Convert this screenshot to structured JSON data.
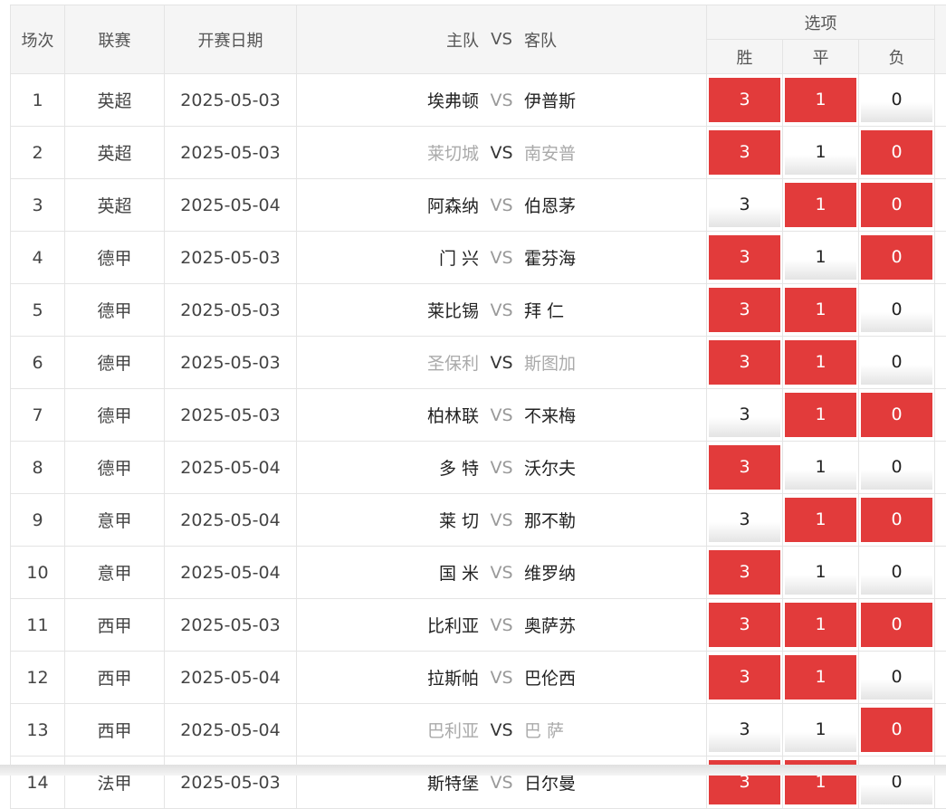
{
  "header": {
    "idx": "场次",
    "league": "联赛",
    "date": "开赛日期",
    "home": "主队",
    "vs": "VS",
    "away": "客队",
    "options_group": "选项",
    "win": "胜",
    "draw": "平",
    "loss": "负"
  },
  "rows": [
    {
      "idx": "1",
      "league": "英超",
      "date": "2025-05-03",
      "home": "埃弗顿",
      "vs": "VS",
      "away": "伊普斯",
      "win": "3",
      "draw": "1",
      "loss": "0",
      "sel": [
        true,
        true,
        false
      ],
      "dim": false
    },
    {
      "idx": "2",
      "league": "英超",
      "date": "2025-05-03",
      "home": "莱切城",
      "vs": "VS",
      "away": "南安普",
      "win": "3",
      "draw": "1",
      "loss": "0",
      "sel": [
        true,
        false,
        true
      ],
      "dim": true
    },
    {
      "idx": "3",
      "league": "英超",
      "date": "2025-05-04",
      "home": "阿森纳",
      "vs": "VS",
      "away": "伯恩茅",
      "win": "3",
      "draw": "1",
      "loss": "0",
      "sel": [
        false,
        true,
        true
      ],
      "dim": false
    },
    {
      "idx": "4",
      "league": "德甲",
      "date": "2025-05-03",
      "home": "门 兴",
      "vs": "VS",
      "away": "霍芬海",
      "win": "3",
      "draw": "1",
      "loss": "0",
      "sel": [
        true,
        false,
        true
      ],
      "dim": false
    },
    {
      "idx": "5",
      "league": "德甲",
      "date": "2025-05-03",
      "home": "莱比锡",
      "vs": "VS",
      "away": "拜 仁",
      "win": "3",
      "draw": "1",
      "loss": "0",
      "sel": [
        true,
        true,
        false
      ],
      "dim": false
    },
    {
      "idx": "6",
      "league": "德甲",
      "date": "2025-05-03",
      "home": "圣保利",
      "vs": "VS",
      "away": "斯图加",
      "win": "3",
      "draw": "1",
      "loss": "0",
      "sel": [
        true,
        true,
        false
      ],
      "dim": true
    },
    {
      "idx": "7",
      "league": "德甲",
      "date": "2025-05-03",
      "home": "柏林联",
      "vs": "VS",
      "away": "不来梅",
      "win": "3",
      "draw": "1",
      "loss": "0",
      "sel": [
        false,
        true,
        true
      ],
      "dim": false
    },
    {
      "idx": "8",
      "league": "德甲",
      "date": "2025-05-04",
      "home": "多 特",
      "vs": "VS",
      "away": "沃尔夫",
      "win": "3",
      "draw": "1",
      "loss": "0",
      "sel": [
        true,
        false,
        false
      ],
      "dim": false
    },
    {
      "idx": "9",
      "league": "意甲",
      "date": "2025-05-04",
      "home": "莱 切",
      "vs": "VS",
      "away": "那不勒",
      "win": "3",
      "draw": "1",
      "loss": "0",
      "sel": [
        false,
        true,
        true
      ],
      "dim": false
    },
    {
      "idx": "10",
      "league": "意甲",
      "date": "2025-05-04",
      "home": "国 米",
      "vs": "VS",
      "away": "维罗纳",
      "win": "3",
      "draw": "1",
      "loss": "0",
      "sel": [
        true,
        false,
        false
      ],
      "dim": false
    },
    {
      "idx": "11",
      "league": "西甲",
      "date": "2025-05-03",
      "home": "比利亚",
      "vs": "VS",
      "away": "奥萨苏",
      "win": "3",
      "draw": "1",
      "loss": "0",
      "sel": [
        true,
        true,
        true
      ],
      "dim": false
    },
    {
      "idx": "12",
      "league": "西甲",
      "date": "2025-05-04",
      "home": "拉斯帕",
      "vs": "VS",
      "away": "巴伦西",
      "win": "3",
      "draw": "1",
      "loss": "0",
      "sel": [
        true,
        true,
        false
      ],
      "dim": false
    },
    {
      "idx": "13",
      "league": "西甲",
      "date": "2025-05-04",
      "home": "巴利亚",
      "vs": "VS",
      "away": "巴 萨",
      "win": "3",
      "draw": "1",
      "loss": "0",
      "sel": [
        false,
        false,
        true
      ],
      "dim": true
    },
    {
      "idx": "14",
      "league": "法甲",
      "date": "2025-05-03",
      "home": "斯特堡",
      "vs": "VS",
      "away": "日尔曼",
      "win": "3",
      "draw": "1",
      "loss": "0",
      "sel": [
        true,
        true,
        false
      ],
      "dim": false
    }
  ],
  "colors": {
    "selected_chip": "#e23b3b",
    "header_bg": "#f5f5f5",
    "dim_team": "#aaaaaa"
  }
}
